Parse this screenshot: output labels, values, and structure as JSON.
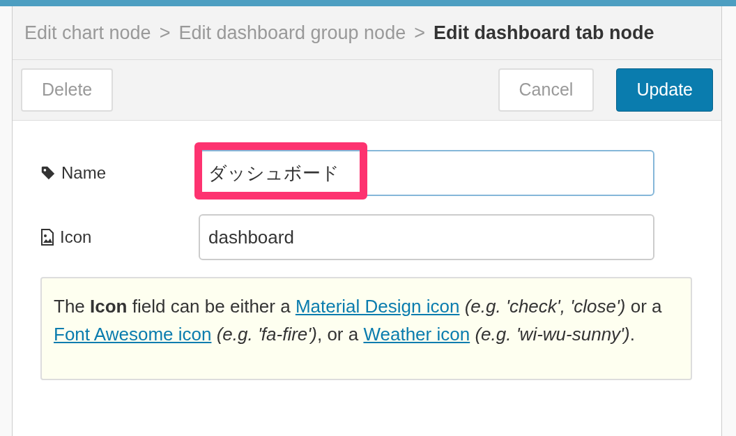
{
  "breadcrumb": [
    {
      "label": "Edit chart node",
      "current": false
    },
    {
      "label": "Edit dashboard group node",
      "current": false
    },
    {
      "label": "Edit dashboard tab node",
      "current": true
    }
  ],
  "separator": ">",
  "buttons": [
    {
      "label": "Delete",
      "kind": "secondary"
    },
    {
      "label": "Cancel",
      "kind": "secondary"
    },
    {
      "label": "Update",
      "kind": "primary"
    }
  ],
  "fields": [
    {
      "kind": "tag",
      "label": "Name",
      "value": "ダッシュボード",
      "focused": true,
      "highlighted": true
    },
    {
      "kind": "image",
      "label": "Icon",
      "value": "dashboard",
      "focused": false,
      "highlighted": false
    }
  ],
  "help": [
    {
      "kind": "text",
      "text": "The **Icon** field can be either a "
    },
    {
      "kind": "link",
      "text": "Material Design icon"
    },
    {
      "kind": "text",
      "text": " *(e.g. 'check', 'close')* or a "
    },
    {
      "kind": "link",
      "text": "Font Awesome icon"
    },
    {
      "kind": "text",
      "text": " *(e.g. 'fa-fire')*, or a "
    },
    {
      "kind": "link",
      "text": "Weather icon"
    },
    {
      "kind": "text",
      "text": " *(e.g. 'wi-wu-sunny')*."
    }
  ]
}
